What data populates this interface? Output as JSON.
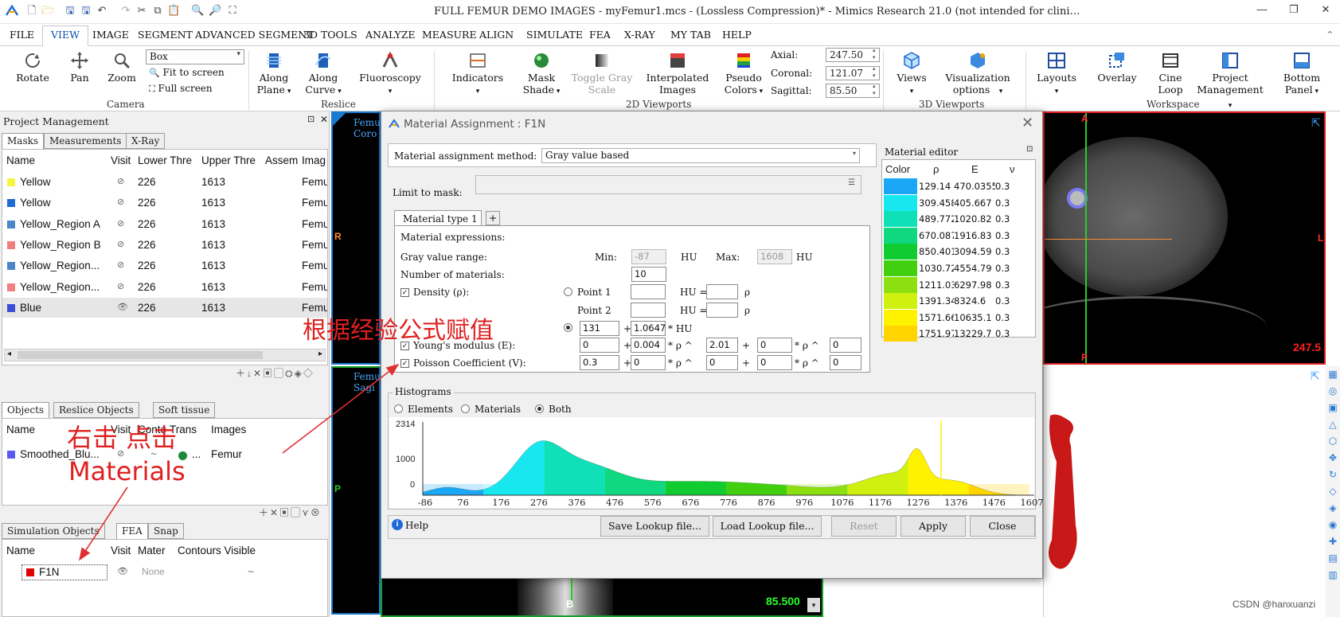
{
  "window": {
    "title": "FULL FEMUR DEMO IMAGES - myFemur1.mcs -  (Lossless Compression)* - Mimics Research 21.0 (not intended for clini…",
    "controls": [
      "—",
      "❐",
      "✕"
    ]
  },
  "menu": [
    "FILE",
    "VIEW",
    "IMAGE",
    "SEGMENT",
    "ADVANCED SEGMENT",
    "3D TOOLS",
    "ANALYZE",
    "MEASURE",
    "ALIGN",
    "SIMULATE",
    "FEA",
    "X-RAY",
    "MY TAB",
    "HELP"
  ],
  "ribbon": {
    "camera": {
      "rotate": "Rotate",
      "pan": "Pan",
      "zoom": "Zoom",
      "box_value": "Box",
      "fit": "Fit to screen",
      "full": "Full screen",
      "group": "Camera"
    },
    "reslice": {
      "plane1": "Along",
      "plane2": "Plane",
      "curve1": "Along",
      "curve2": "Curve",
      "fluoro": "Fluoroscopy",
      "group": "Reslice"
    },
    "viewports2d": {
      "indicators": "Indicators",
      "mask1": "Mask",
      "mask2": "Shade",
      "toggle1": "Toggle Gray",
      "toggle2": "Scale",
      "interp1": "Interpolated",
      "interp2": "Images",
      "pseudo1": "Pseudo",
      "pseudo2": "Colors",
      "axial_l": "Axial:",
      "axial_v": "247.50",
      "coronal_l": "Coronal:",
      "coronal_v": "121.07",
      "sagittal_l": "Sagittal:",
      "sagittal_v": "85.50",
      "group": "2D Viewports"
    },
    "viewports3d": {
      "views": "Views",
      "vis1": "Visualization",
      "vis2": "options",
      "group": "3D Viewports"
    },
    "workspace": {
      "layouts": "Layouts",
      "overlay": "Overlay",
      "cine1": "Cine",
      "cine2": "Loop",
      "proj1": "Project",
      "proj2": "Management",
      "bottom1": "Bottom",
      "bottom2": "Panel",
      "group": "Workspace"
    }
  },
  "project_panel": {
    "title": "Project Management",
    "tabs": [
      "Masks",
      "Measurements",
      "X-Ray"
    ],
    "columns": [
      "Name",
      "Visit",
      "Lower Thre",
      "Upper Thre",
      "Assem",
      "Imag"
    ],
    "rows": [
      {
        "name": "Yellow",
        "color": "#f5f542",
        "vis": "⊘",
        "lower": "226",
        "upper": "1613",
        "img": "Femu"
      },
      {
        "name": "Yellow",
        "color": "#1f6bd6",
        "vis": "⊘",
        "lower": "226",
        "upper": "1613",
        "img": "Femu"
      },
      {
        "name": "Yellow_Region A",
        "color": "#4a86c8",
        "vis": "⊘",
        "lower": "226",
        "upper": "1613",
        "img": "Femu"
      },
      {
        "name": "Yellow_Region B",
        "color": "#f08080",
        "vis": "⊘",
        "lower": "226",
        "upper": "1613",
        "img": "Femu"
      },
      {
        "name": "Yellow_Region...",
        "color": "#4a86c8",
        "vis": "⊘",
        "lower": "226",
        "upper": "1613",
        "img": "Femu"
      },
      {
        "name": "Yellow_Region...",
        "color": "#f08080",
        "vis": "⊘",
        "lower": "226",
        "upper": "1613",
        "img": "Femu"
      },
      {
        "name": "Blue",
        "color": "#3a4fd6",
        "vis": "👁",
        "lower": "226",
        "upper": "1613",
        "img": "Femu"
      }
    ]
  },
  "objects_panel": {
    "tabs": [
      "Objects",
      "Reslice Objects",
      "Soft tissue"
    ],
    "columns": [
      "Name",
      "Visit",
      "Conto",
      "Trans",
      "Images"
    ],
    "row": {
      "name": "Smoothed_Blu...",
      "vis": "⊘",
      "contour": "~",
      "trans": "...",
      "images": "Femur"
    }
  },
  "sim_panel": {
    "tabs": [
      "Simulation Objects",
      "FEA",
      "Snap"
    ],
    "columns": [
      "Name",
      "Visit",
      "Mater",
      "Contours Visible"
    ],
    "row": {
      "name": "F1N",
      "mater": "None",
      "contour": "~"
    }
  },
  "viewports": {
    "top_label1": "Femu",
    "top_label2": "Coro",
    "mid_label1": "Femu",
    "mid_label2": "Sagi",
    "axial_A": "A",
    "axial_P": "P",
    "axial_L": "L",
    "axial_R": "R",
    "axial_value": "247.5",
    "bottom_B": "B",
    "bottom_value": "85.500",
    "left_P": "P"
  },
  "dialog": {
    "title": "Material Assignment : F1N",
    "method_label": "Material assignment method:",
    "method_value": "Gray value based",
    "limit_label": "Limit to mask:",
    "tab_label": "Material type 1",
    "add_tab": "+",
    "expressions_label": "Material expressions:",
    "gray_range_label": "Gray value range:",
    "min_label": "Min:",
    "min_value": "-87",
    "hu1": "HU",
    "max_label": "Max:",
    "max_value": "1608",
    "hu2": "HU",
    "num_label": "Number of materials:",
    "num_value": "10",
    "density_label": "Density (ρ):",
    "point1_label": "Point 1",
    "point2_label": "Point 2",
    "hu_eq": "HU =",
    "rho": "ρ",
    "dens_a": "131",
    "dens_b": "1.0647",
    "dens_plus": "+",
    "dens_times": "* HU",
    "young_label": "Young's modulus (E):",
    "young_a": "0",
    "young_b": "0.004",
    "young_c": "2.01",
    "young_d": "0",
    "young_e": "0",
    "poisson_label": "Poisson Coefficient (V):",
    "poisson_a": "0.3",
    "poisson_b": "0",
    "poisson_c": "0",
    "poisson_d": "0",
    "poisson_e": "0",
    "op_plus": "+",
    "op_rho": "* ρ ^",
    "op_rho2": "* ρ ^",
    "editor_title": "Material editor",
    "editor_cols": [
      "Color",
      "ρ",
      "E",
      "ν"
    ],
    "materials": [
      {
        "color": "#1aa7f5",
        "rho": "129.14",
        "e": "470.0355",
        "v": "0.3"
      },
      {
        "color": "#18e7f0",
        "rho": "309.458",
        "e": "405.667",
        "v": "0.3"
      },
      {
        "color": "#10e0b8",
        "rho": "489.772",
        "e": "1020.82",
        "v": "0.3"
      },
      {
        "color": "#10d880",
        "rho": "670.087",
        "e": "1916.83",
        "v": "0.3"
      },
      {
        "color": "#10cc30",
        "rho": "850.401",
        "e": "3094.59",
        "v": "0.3"
      },
      {
        "color": "#40d010",
        "rho": "1030.72",
        "e": "4554.79",
        "v": "0.3"
      },
      {
        "color": "#8ce010",
        "rho": "1211.03",
        "e": "6297.98",
        "v": "0.3"
      },
      {
        "color": "#d0f010",
        "rho": "1391.34",
        "e": "8324.6",
        "v": "0.3"
      },
      {
        "color": "#fff200",
        "rho": "1571.66",
        "e": "10635.1",
        "v": "0.3"
      },
      {
        "color": "#ffd400",
        "rho": "1751.97",
        "e": "13229.7",
        "v": "0.3"
      }
    ],
    "histogram": {
      "title": "Histograms",
      "opt_elements": "Elements",
      "opt_materials": "Materials",
      "opt_both": "Both",
      "y_ticks": [
        "2314",
        "1000",
        "0"
      ],
      "x_ticks": [
        "-86",
        "76",
        "176",
        "276",
        "376",
        "476",
        "576",
        "676",
        "776",
        "876",
        "976",
        "1076",
        "1176",
        "1276",
        "1376",
        "1476",
        "1607"
      ]
    },
    "buttons": {
      "help": "Help",
      "save": "Save Lookup file...",
      "load": "Load Lookup file...",
      "reset": "Reset",
      "apply": "Apply",
      "close": "Close"
    }
  },
  "annotations": {
    "formula_note": "根据经验公式赋值",
    "right_click_note": "右击 点击",
    "materials_note": "Materials"
  },
  "watermark": "CSDN @hanxuanzi"
}
